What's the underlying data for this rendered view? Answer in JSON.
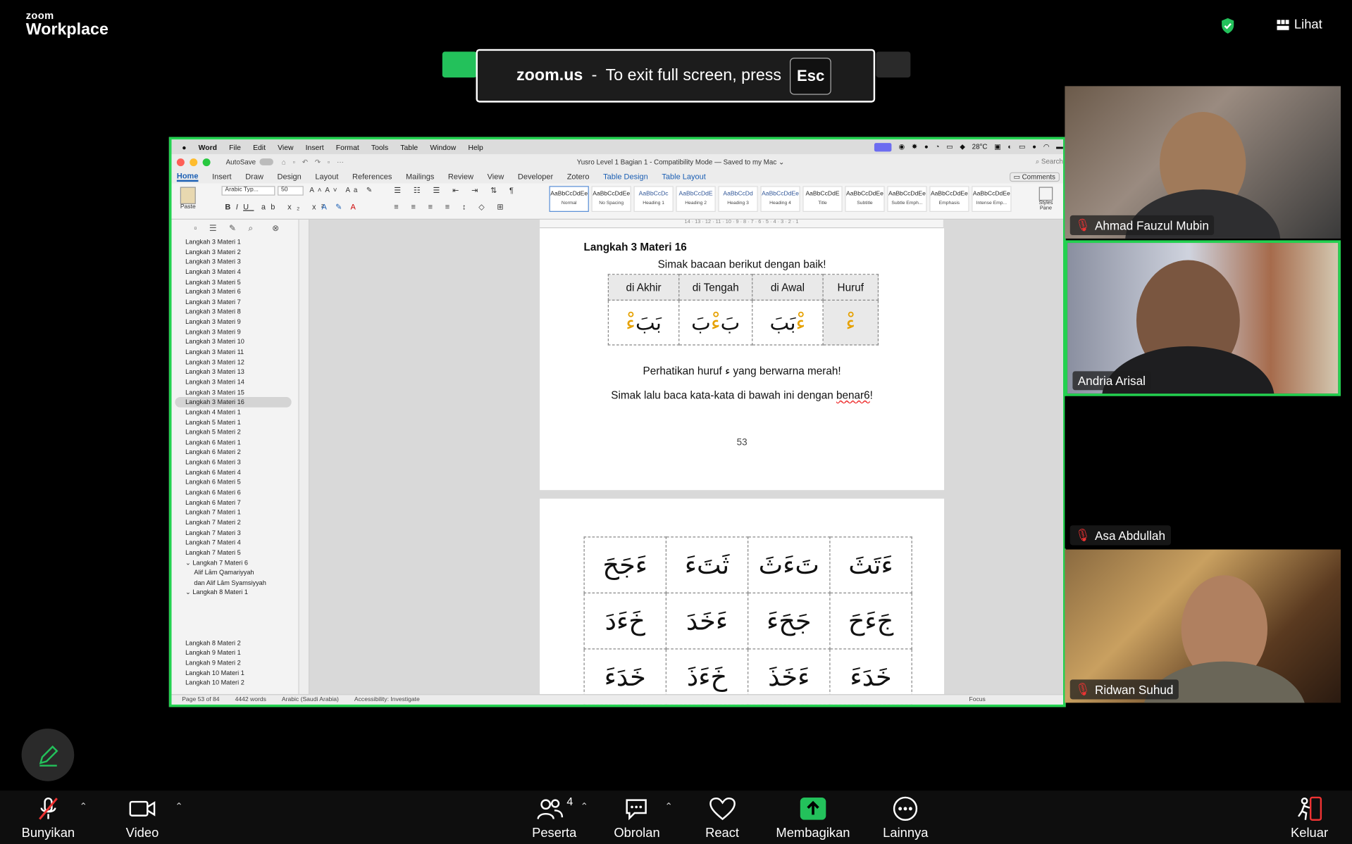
{
  "app": {
    "brand_small": "zoom",
    "brand_big": "Workplace",
    "view_label": "Lihat"
  },
  "toast": {
    "host": "zoom.us",
    "sep": "-",
    "message": "To exit full screen, press",
    "key": "Esc"
  },
  "mac_menu": [
    "Word",
    "File",
    "Edit",
    "View",
    "Insert",
    "Format",
    "Tools",
    "Table",
    "Window",
    "Help"
  ],
  "mac_status": {
    "weather": "28°C"
  },
  "word": {
    "autosave": "AutoSave",
    "doc_title": "Yusro Level 1 Bagian 1 - Compatibility Mode — Saved to my Mac ⌄",
    "search": "Search",
    "tabs": [
      "Home",
      "Insert",
      "Draw",
      "Design",
      "Layout",
      "References",
      "Mailings",
      "Review",
      "View",
      "Developer",
      "Zotero",
      "Table Design",
      "Table Layout"
    ],
    "comments": "Comments",
    "font": "Arabic Typ...",
    "size": "50",
    "paste": "Paste",
    "styles": [
      {
        "sample": "AaBbCcDdEe",
        "name": "Normal"
      },
      {
        "sample": "AaBbCcDdEe",
        "name": "No Spacing"
      },
      {
        "sample": "AaBbCcDc",
        "name": "Heading 1"
      },
      {
        "sample": "AaBbCcDdE",
        "name": "Heading 2"
      },
      {
        "sample": "AaBbCcDd",
        "name": "Heading 3"
      },
      {
        "sample": "AaBbCcDdEe",
        "name": "Heading 4"
      },
      {
        "sample": "AaBbCcDdE",
        "name": "Title"
      },
      {
        "sample": "AaBbCcDdEe",
        "name": "Subtitle"
      },
      {
        "sample": "AaBbCcDdEe",
        "name": "Subtle Emph..."
      },
      {
        "sample": "AaBbCcDdEe",
        "name": "Emphasis"
      },
      {
        "sample": "AaBbCcDdEe",
        "name": "Intense Emp..."
      }
    ],
    "styles_pane": "Styles Pane",
    "nav_items": [
      {
        "t": "Langkah 3 Materi 1"
      },
      {
        "t": "Langkah 3 Materi 2"
      },
      {
        "t": "Langkah 3 Materi 3"
      },
      {
        "t": "Langkah 3 Materi 4"
      },
      {
        "t": "Langkah 3 Materi 5"
      },
      {
        "t": "Langkah 3 Materi 6"
      },
      {
        "t": "Langkah 3 Materi 7"
      },
      {
        "t": "Langkah 3 Materi 8"
      },
      {
        "t": "Langkah 3 Materi 9"
      },
      {
        "t": "Langkah 3 Materi 9"
      },
      {
        "t": "Langkah 3 Materi 10"
      },
      {
        "t": "Langkah 3 Materi 11"
      },
      {
        "t": "Langkah 3 Materi 12"
      },
      {
        "t": "Langkah 3 Materi 13"
      },
      {
        "t": "Langkah 3 Materi 14"
      },
      {
        "t": "Langkah 3 Materi 15"
      },
      {
        "t": "Langkah 3 Materi 16",
        "sel": true
      },
      {
        "t": "Langkah 4 Materi 1"
      },
      {
        "t": "Langkah 5 Materi 1"
      },
      {
        "t": "Langkah 5 Materi 2"
      },
      {
        "t": "Langkah 6 Materi 1"
      },
      {
        "t": "Langkah 6 Materi 2"
      },
      {
        "t": "Langkah 6 Materi 3"
      },
      {
        "t": "Langkah 6 Materi 4"
      },
      {
        "t": "Langkah 6 Materi 5"
      },
      {
        "t": "Langkah 6 Materi 6"
      },
      {
        "t": "Langkah 6 Materi 7"
      },
      {
        "t": "Langkah 7 Materi 1"
      },
      {
        "t": "Langkah 7 Materi 2"
      },
      {
        "t": "Langkah 7 Materi 3"
      },
      {
        "t": "Langkah 7 Materi 4"
      },
      {
        "t": "Langkah 7 Materi 5"
      },
      {
        "t": "⌄ Langkah 7 Materi 6"
      },
      {
        "t": "Alif Lām Qamariyyah",
        "sub": true
      },
      {
        "t": "dan Alif Lām Syamsiyyah",
        "sub": true
      },
      {
        "t": "⌄ Langkah 8 Materi 1"
      },
      {
        "t": ""
      },
      {
        "t": ""
      },
      {
        "t": ""
      },
      {
        "t": ""
      },
      {
        "t": "Langkah 8 Materi 2"
      },
      {
        "t": "Langkah 9 Materi 1"
      },
      {
        "t": "Langkah 9 Materi 2"
      },
      {
        "t": "Langkah 10 Materi 1"
      },
      {
        "t": "Langkah 10 Materi 2"
      }
    ],
    "ruler": "14 · 13 · 12 · 11 · 10 · 9 · 8 · 7 · 6 · 5 · 4 · 3 · 2 · 1",
    "page1": {
      "heading": "Langkah 3 Materi 16",
      "instruction": "Simak bacaan berikut dengan baik!",
      "table_headers": [
        "di Akhir",
        "di Tengah",
        "di Awal",
        "Huruf"
      ],
      "table_cells": [
        [
          "بَبَ",
          "ءْ"
        ],
        [
          "بَ",
          "ءْ",
          "بَ"
        ],
        [
          "ءْ",
          "بَبَ"
        ],
        [
          "ءْ"
        ]
      ],
      "note_before": "Perhatikan huruf ",
      "note_letter": "ء",
      "note_after": " yang berwarna merah!",
      "line2_before": "Simak lalu baca kata-kata di bawah ini dengan ",
      "line2_word": "benar6",
      "line2_after": "!",
      "page_number": "53"
    },
    "page2": {
      "rows": [
        [
          "ءَجَحَ",
          "ثَتَءَ",
          "تَءَثَ",
          "ءَتَثَ"
        ],
        [
          "خَءَدَ",
          "ءَخَدَ",
          "جَحَءَ",
          "جَءَحَ"
        ],
        [
          "خَدَءَ",
          "خَءَذَ",
          "ءَخَذَ",
          "خَدَءَ"
        ]
      ]
    },
    "status": {
      "page": "Page 53 of 84",
      "words": "4442 words",
      "lang": "Arabic (Saudi Arabia)",
      "access": "Accessibility: Investigate",
      "focus": "Focus"
    }
  },
  "participants": [
    {
      "name": "Ahmad Fauzul Mubin",
      "muted": true
    },
    {
      "name": "Andria Arisal",
      "muted": false,
      "speaking": true
    },
    {
      "name": "Asa Abdullah",
      "muted": true
    },
    {
      "name": "Ridwan Suhud",
      "muted": true
    }
  ],
  "toolbar": {
    "mute": "Bunyikan",
    "video": "Video",
    "participants": "Peserta",
    "participants_count": "4",
    "chat": "Obrolan",
    "react": "React",
    "share": "Membagikan",
    "more": "Lainnya",
    "leave": "Keluar"
  }
}
